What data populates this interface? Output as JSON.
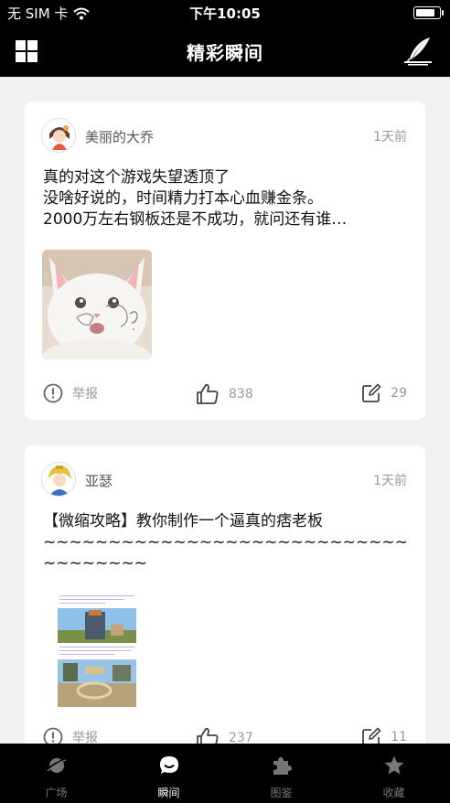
{
  "status_bar": {
    "carrier": "无 SIM 卡",
    "time": "下午10:05"
  },
  "nav": {
    "title": "精彩瞬间",
    "menu_icon": "grid-icon",
    "compose_icon": "quill-icon"
  },
  "posts": [
    {
      "username": "美丽的大乔",
      "time": "1天前",
      "lines": [
        "真的对这个游戏失望透顶了",
        "没啥好说的，时间精力打本心血赚金条。",
        "2000万左右钢板还是不成功，就问还有谁…"
      ],
      "image": "white-kitten-photo",
      "report_label": "举报",
      "likes": "838",
      "comments": "29"
    },
    {
      "username": "亚瑟",
      "time": "1天前",
      "lines": [
        "【微缩攻略】教你制作一个逼真的痞老板",
        "~~~~~~~~~~~~~~~~~~~~~~~~~~~~~~~~~~~~",
        "~~~~~~~~"
      ],
      "image": "game-screenshots",
      "image_caption_top": "来看的象征问题？今天我们在游戏中还原一个逼真的游戏颜色！",
      "image_caption_mid": "第一步：请先找到这个人物的位置，在它的身上找到位置之后",
      "report_label": "举报",
      "likes": "237",
      "comments": "11"
    }
  ],
  "tabs": [
    {
      "label": "广场",
      "icon": "planet-icon",
      "active": false
    },
    {
      "label": "瞬间",
      "icon": "chat-bubble-icon",
      "active": true
    },
    {
      "label": "图鉴",
      "icon": "puzzle-icon",
      "active": false
    },
    {
      "label": "收藏",
      "icon": "star-icon",
      "active": false
    }
  ],
  "colors": {
    "bar_bg": "#000000",
    "page_bg": "#f2f2f2",
    "card_bg": "#ffffff",
    "muted_text": "#999999",
    "tab_inactive": "#777777",
    "tab_active": "#ffffff"
  }
}
